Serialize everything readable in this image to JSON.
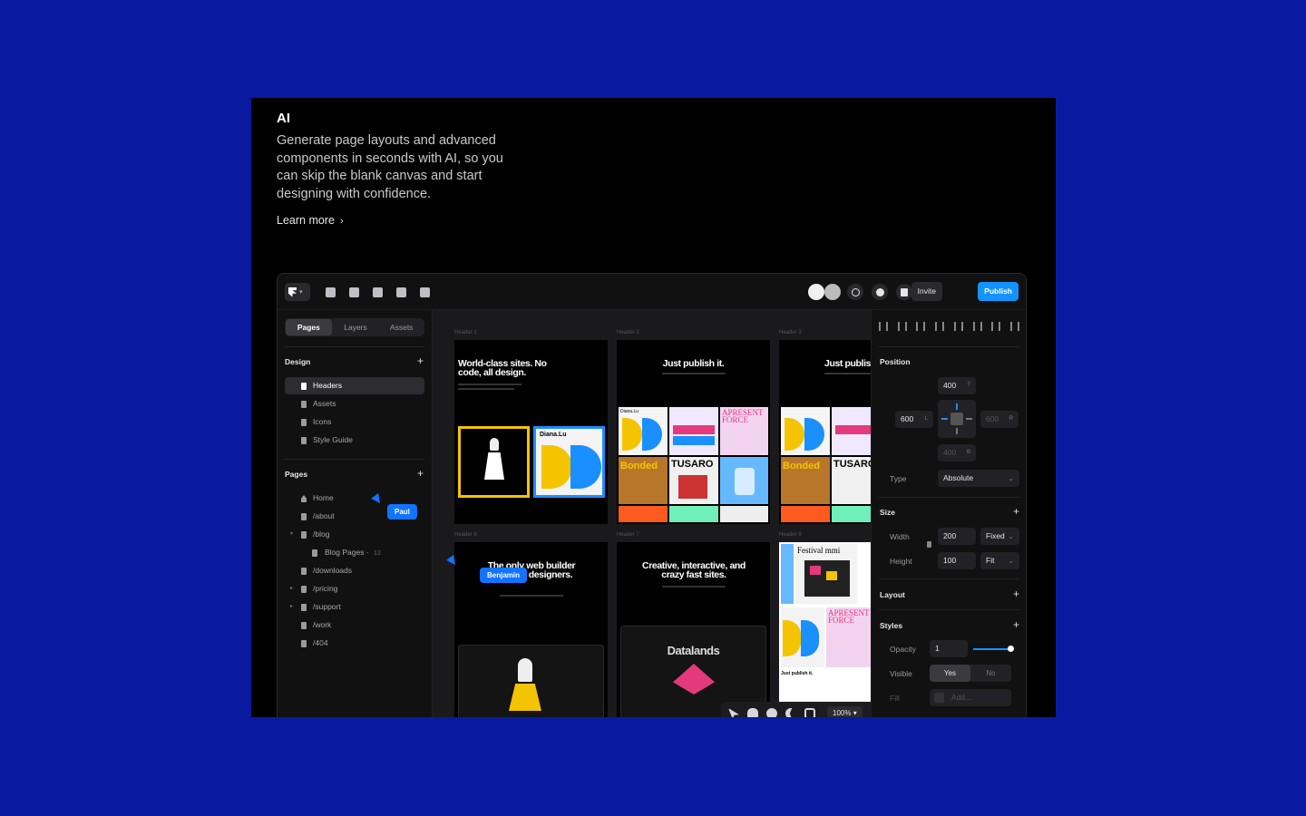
{
  "hero": {
    "title": "AI",
    "description": "Generate page layouts and advanced components in seconds with AI, so you can skip the blank canvas and start designing with confidence.",
    "learn_more": "Learn more"
  },
  "toolbar": {
    "invite_label": "Invite",
    "publish_label": "Publish",
    "tool_icons": [
      "insert-icon",
      "layout-icon",
      "text-icon",
      "vector-icon",
      "cms-icon"
    ],
    "right_icons": [
      "globe-icon",
      "record-icon",
      "analytics-icon",
      "play-icon"
    ]
  },
  "left_panel": {
    "tabs": [
      "Pages",
      "Layers",
      "Assets"
    ],
    "design_heading": "Design",
    "design_items": [
      "Headers",
      "Assets",
      "Icons",
      "Style Guide"
    ],
    "pages_heading": "Pages",
    "page_items": [
      {
        "label": "Home"
      },
      {
        "label": "/about"
      },
      {
        "label": "/blog"
      },
      {
        "label": "Blog Pages",
        "count": "12"
      },
      {
        "label": "/downloads"
      },
      {
        "label": "/pricing"
      },
      {
        "label": "/support"
      },
      {
        "label": "/work"
      },
      {
        "label": "/404"
      }
    ]
  },
  "cursors": {
    "paul": "Paul",
    "benjamin": "Benjamin"
  },
  "canvas": {
    "frame_labels": [
      "Header 1",
      "Header 2",
      "Header 3",
      "Header 6",
      "Header 7",
      "Header 8"
    ],
    "frame_titles": [
      "World-class sites. No code, all design.",
      "Just publish it.",
      "Just publis",
      "The only web builder loved by designers.",
      "Creative, interactive, and crazy fast sites.",
      "Festival mmi"
    ],
    "thumb_texts": {
      "diana": "Diana.Lu",
      "apresent": "APRESENT FORCE",
      "bonded": "Bonded",
      "tusaro": "TUSARO",
      "datalands": "Datalands",
      "just_publish": "Just publish it."
    }
  },
  "zoom": {
    "value": "100%"
  },
  "right_panel": {
    "position_heading": "Position",
    "top": {
      "value": "400",
      "suffix": "T"
    },
    "left": {
      "value": "600",
      "suffix": "L"
    },
    "right": {
      "value": "600",
      "suffix": "R"
    },
    "bottom": {
      "value": "400",
      "suffix": "B"
    },
    "type_label": "Type",
    "type_value": "Absolute",
    "size_heading": "Size",
    "width_label": "Width",
    "width_value": "200",
    "width_mode": "Fixed",
    "height_label": "Height",
    "height_value": "100",
    "height_mode": "Fit",
    "layout_heading": "Layout",
    "styles_heading": "Styles",
    "opacity_label": "Opacity",
    "opacity_value": "1",
    "visible_label": "Visible",
    "visible_yes": "Yes",
    "visible_no": "No",
    "fill_label": "Fill",
    "fill_placeholder": "Add..."
  },
  "colors": {
    "background": "#0a1aa0",
    "accent": "#1493ff",
    "cursor": "#1273ff",
    "yellow": "#f5c400"
  }
}
